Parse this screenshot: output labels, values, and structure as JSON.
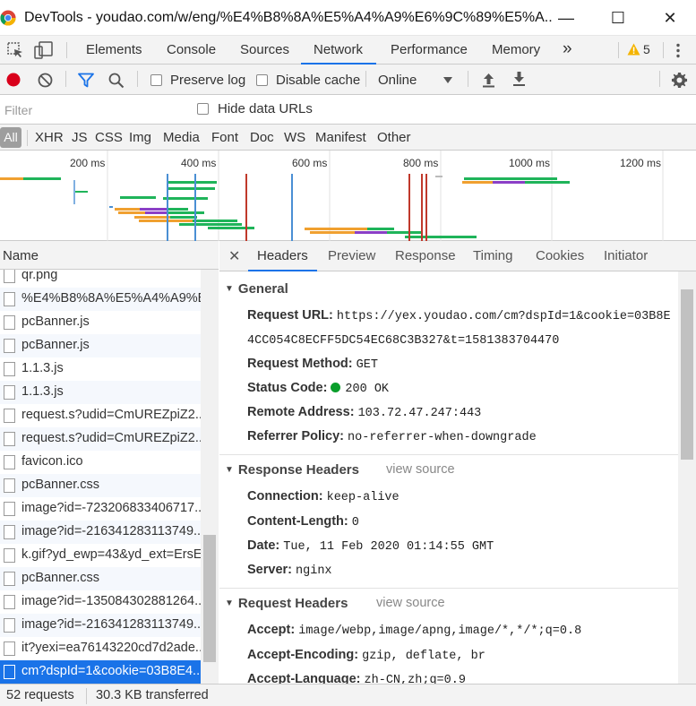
{
  "window": {
    "title": "DevTools - youdao.com/w/eng/%E4%B8%8A%E5%A4%A9%E6%9C%89%E5%A...",
    "minimize_glyph": "—",
    "maximize_glyph": "☐",
    "close_glyph": "✕"
  },
  "tabs": {
    "items": [
      "Elements",
      "Console",
      "Sources",
      "Network",
      "Performance",
      "Memory"
    ],
    "active": "Network",
    "more_glyph": "»",
    "warning_count": "5"
  },
  "toolbar": {
    "preserve_log": "Preserve log",
    "disable_cache": "Disable cache",
    "throttle": "Online"
  },
  "filter": {
    "placeholder": "Filter",
    "hide_data_urls": "Hide data URLs"
  },
  "types": [
    "All",
    "XHR",
    "JS",
    "CSS",
    "Img",
    "Media",
    "Font",
    "Doc",
    "WS",
    "Manifest",
    "Other"
  ],
  "overview": {
    "ticks": [
      "200 ms",
      "400 ms",
      "600 ms",
      "800 ms",
      "1000 ms",
      "1200 ms"
    ]
  },
  "request_list": {
    "header": "Name",
    "rows": [
      "qr.png",
      "%E4%B8%8A%E5%A4%A9%E6%9C%89",
      "pcBanner.js",
      "pcBanner.js",
      "1.1.3.js",
      "1.1.3.js",
      "request.s?udid=CmUREZpiZ2...",
      "request.s?udid=CmUREZpiZ2...",
      "favicon.ico",
      "pcBanner.css",
      "image?id=-723206833406717...",
      "image?id=-216341283113749...",
      "k.gif?yd_ewp=43&yd_ext=ErsE",
      "pcBanner.css",
      "image?id=-135084302881264...",
      "image?id=-216341283113749...",
      "it?yexi=ea76143220cd7d2ade...",
      "cm?dspId=1&cookie=03B8E4..."
    ],
    "selected_index": 17
  },
  "detail": {
    "tabs": [
      "Headers",
      "Preview",
      "Response",
      "Timing",
      "Cookies",
      "Initiator"
    ],
    "active_tab": "Headers",
    "close_glyph": "✕",
    "general": {
      "title": "General",
      "request_url_label": "Request URL:",
      "request_url_value": "https://yex.youdao.com/cm?dspId=1&cookie=03B8E",
      "request_url_value_cont": "4CC054C8ECFF5DC54EC68C3B327&t=1581383704470",
      "method_label": "Request Method:",
      "method_value": "GET",
      "status_label": "Status Code:",
      "status_value": "200 OK",
      "status_color": "#0a9e2b",
      "remote_label": "Remote Address:",
      "remote_value": "103.72.47.247:443",
      "referrer_label": "Referrer Policy:",
      "referrer_value": "no-referrer-when-downgrade"
    },
    "response_headers": {
      "title": "Response Headers",
      "view_source": "view source",
      "items": [
        {
          "k": "Connection:",
          "v": "keep-alive"
        },
        {
          "k": "Content-Length:",
          "v": "0"
        },
        {
          "k": "Date:",
          "v": "Tue, 11 Feb 2020 01:14:55 GMT"
        },
        {
          "k": "Server:",
          "v": "nginx"
        }
      ]
    },
    "request_headers": {
      "title": "Request Headers",
      "view_source": "view source",
      "items": [
        {
          "k": "Accept:",
          "v": "image/webp,image/apng,image/*,*/*;q=0.8"
        },
        {
          "k": "Accept-Encoding:",
          "v": "gzip, deflate, br"
        },
        {
          "k": "Accept-Language:",
          "v": "zh-CN,zh;q=0.9"
        }
      ]
    }
  },
  "statusbar": {
    "requests": "52 requests",
    "transferred": "30.3 KB transferred"
  },
  "colors": {
    "accent": "#1a73e8",
    "record": "#d9001b",
    "filter_icon": "#1a73e8",
    "warning": "#f4b400"
  }
}
